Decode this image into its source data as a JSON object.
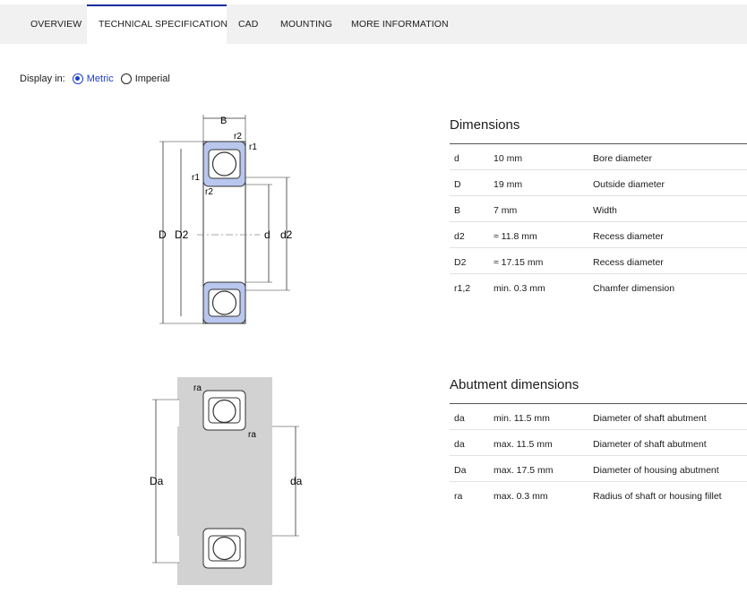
{
  "tabs": [
    {
      "label": "OVERVIEW",
      "active": false
    },
    {
      "label": "TECHNICAL SPECIFICATION",
      "active": true
    },
    {
      "label": "CAD",
      "active": false
    },
    {
      "label": "MOUNTING",
      "active": false
    },
    {
      "label": "MORE INFORMATION",
      "active": false
    }
  ],
  "display": {
    "label": "Display in:",
    "options": [
      {
        "label": "Metric",
        "selected": true
      },
      {
        "label": "Imperial",
        "selected": false
      }
    ]
  },
  "diagram1": {
    "labels": {
      "B": "B",
      "r2_top": "r2",
      "r1_top": "r1",
      "r1_left": "r1",
      "r2_left": "r2",
      "D": "D",
      "D2": "D2",
      "d": "d",
      "d2": "d2"
    }
  },
  "diagram2": {
    "labels": {
      "ra_top": "ra",
      "ra_mid": "ra",
      "Da": "Da",
      "da": "da"
    }
  },
  "dimensions": {
    "title": "Dimensions",
    "rows": [
      {
        "symbol": "d",
        "value": "10 mm",
        "description": "Bore diameter"
      },
      {
        "symbol": "D",
        "value": "19 mm",
        "description": "Outside diameter"
      },
      {
        "symbol": "B",
        "value": "7 mm",
        "description": "Width"
      },
      {
        "symbol": "d2",
        "value": "≈ 11.8 mm",
        "description": "Recess diameter"
      },
      {
        "symbol": "D2",
        "value": "≈ 17.15 mm",
        "description": "Recess diameter"
      },
      {
        "symbol": "r1,2",
        "value": "min. 0.3 mm",
        "description": "Chamfer dimension"
      }
    ]
  },
  "abutment": {
    "title": "Abutment dimensions",
    "rows": [
      {
        "symbol": "da",
        "value": "min. 11.5 mm",
        "description": "Diameter of shaft abutment"
      },
      {
        "symbol": "da",
        "value": "max. 11.5 mm",
        "description": "Diameter of shaft abutment"
      },
      {
        "symbol": "Da",
        "value": "max. 17.5 mm",
        "description": "Diameter of housing abutment"
      },
      {
        "symbol": "ra",
        "value": "max. 0.3 mm",
        "description": "Radius of shaft or housing fillet"
      }
    ]
  },
  "colors": {
    "accent": "#1b3fc4",
    "tabbar": "#f1f1f1",
    "seal": "#b9c7ee",
    "housing": "#d2d2d2"
  }
}
